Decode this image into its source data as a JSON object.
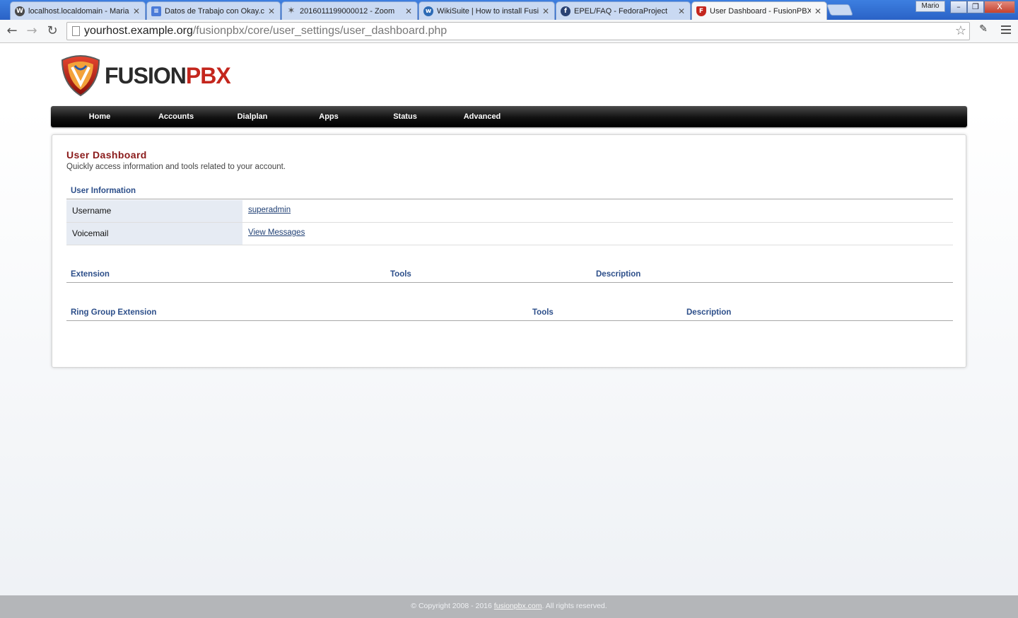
{
  "browser": {
    "tabs": [
      {
        "title": "localhost.localdomain - MariaDB",
        "icon": "wordpress-icon"
      },
      {
        "title": "Datos de Trabajo con Okay.c",
        "icon": "google-docs-icon"
      },
      {
        "title": "2016011199000012 - Zoom",
        "icon": "zoom-star-icon"
      },
      {
        "title": "WikiSuite | How to install Fusi",
        "icon": "wikisuite-icon"
      },
      {
        "title": "EPEL/FAQ - FedoraProject",
        "icon": "fedora-icon"
      },
      {
        "title": "User Dashboard - FusionPBX",
        "icon": "fusionpbx-icon"
      }
    ],
    "profile_name": "Mario",
    "window_buttons": {
      "minimize": "–",
      "restore": "❐",
      "close": "X"
    },
    "url_host": "yourhost.example.org",
    "url_path": "/fusionpbx/core/user_settings/user_dashboard.php"
  },
  "site": {
    "logo_fusion": "FUSION",
    "logo_pbx": "PBX",
    "nav": [
      "Home",
      "Accounts",
      "Dialplan",
      "Apps",
      "Status",
      "Advanced"
    ]
  },
  "dashboard": {
    "title": "User Dashboard",
    "subtitle": "Quickly access information and tools related to your account.",
    "user_info": {
      "heading": "User Information",
      "rows": [
        {
          "label": "Username",
          "value": "superadmin"
        },
        {
          "label": "Voicemail",
          "value": "View Messages"
        }
      ]
    },
    "extension_table": {
      "headers": [
        "Extension",
        "Tools",
        "Description"
      ]
    },
    "ring_group_table": {
      "headers": [
        "Ring Group Extension",
        "Tools",
        "Description"
      ]
    }
  },
  "footer": {
    "prefix": "© Copyright 2008 - 2016 ",
    "link": "fusionpbx.com",
    "suffix": ". All rights reserved."
  },
  "colors": {
    "accent_red": "#8a1a1a",
    "heading_blue": "#2d4f8a",
    "nav_black": "#000000"
  }
}
